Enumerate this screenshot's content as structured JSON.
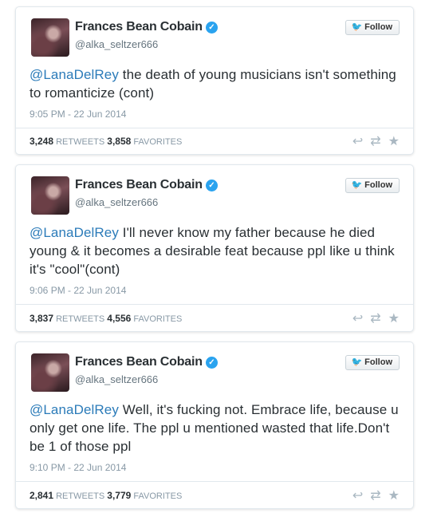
{
  "tweets": [
    {
      "name": "Frances Bean Cobain",
      "handle": "@alka_seltzer666",
      "follow_label": "Follow",
      "mention": "@LanaDelRey",
      "body": " the death of young musicians isn't something to romanticize (cont)",
      "time": "9:05 PM - 22 Jun 2014",
      "retweets": "3,248",
      "retweets_label": "RETWEETS",
      "favorites": "3,858",
      "favorites_label": "FAVORITES"
    },
    {
      "name": "Frances Bean Cobain",
      "handle": "@alka_seltzer666",
      "follow_label": "Follow",
      "mention": "@LanaDelRey",
      "body": " I'll never know my father because he died young & it becomes a desirable feat because ppl like u think it's \"cool\"(cont)",
      "time": "9:06 PM - 22 Jun 2014",
      "retweets": "3,837",
      "retweets_label": "RETWEETS",
      "favorites": "4,556",
      "favorites_label": "FAVORITES"
    },
    {
      "name": "Frances Bean Cobain",
      "handle": "@alka_seltzer666",
      "follow_label": "Follow",
      "mention": "@LanaDelRey",
      "body": " Well, it's fucking not. Embrace life, because u only get one life.  The ppl u mentioned wasted that life.Don't be 1 of those ppl",
      "time": "9:10 PM - 22 Jun 2014",
      "retweets": "2,841",
      "retweets_label": "RETWEETS",
      "favorites": "3,779",
      "favorites_label": "FAVORITES"
    }
  ],
  "icons": {
    "verified": "verified-badge-icon",
    "follow": "twitter-bird-icon",
    "reply": "reply-icon",
    "retweet": "retweet-icon",
    "favorite": "star-icon"
  },
  "colors": {
    "mention": "#2b7bb9",
    "verified": "#2aa3ef",
    "muted": "#8899a6"
  }
}
